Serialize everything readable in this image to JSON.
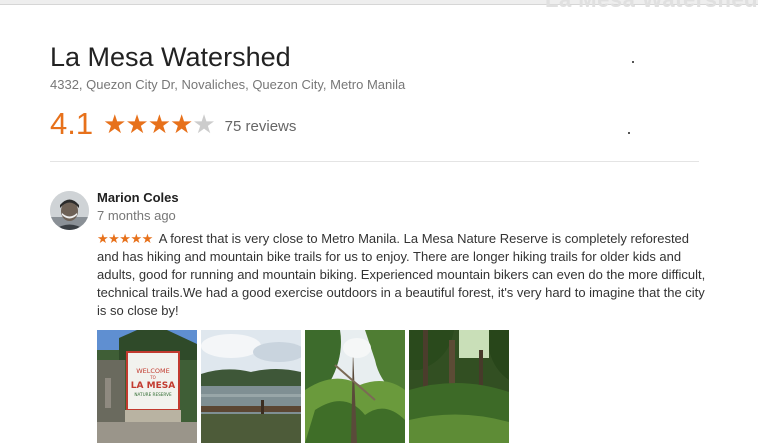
{
  "header": {
    "ghost_text": "La Mesa Watershed"
  },
  "place": {
    "title": "La Mesa Watershed",
    "address": "4332, Quezon City Dr, Novaliches, Quezon City, Metro Manila",
    "rating": "4.1",
    "rating_stars_filled": 4,
    "rating_stars_total": 5,
    "review_count_label": "75 reviews"
  },
  "review": {
    "author": "Marion Coles",
    "date": "7 months ago",
    "stars": "★★★★★",
    "text": "A forest that is very close to Metro Manila. La Mesa Nature Reserve is completely reforested and has hiking and mountain bike trails for us to enjoy. There are longer hiking trails for older kids and adults, good for running and mountain biking.  Experienced mountain bikers can even do the more difficult, technical trails.We had a good exercise outdoors in a beautiful forest, it's very hard to imagine that the city is so close by!",
    "photo_sign_text": [
      "WELCOME",
      "TO",
      "LA MESA",
      "NATURE RESERVE"
    ]
  },
  "colors": {
    "accent": "#e7711b",
    "star_off": "#cccccc",
    "text_muted": "#777777"
  }
}
